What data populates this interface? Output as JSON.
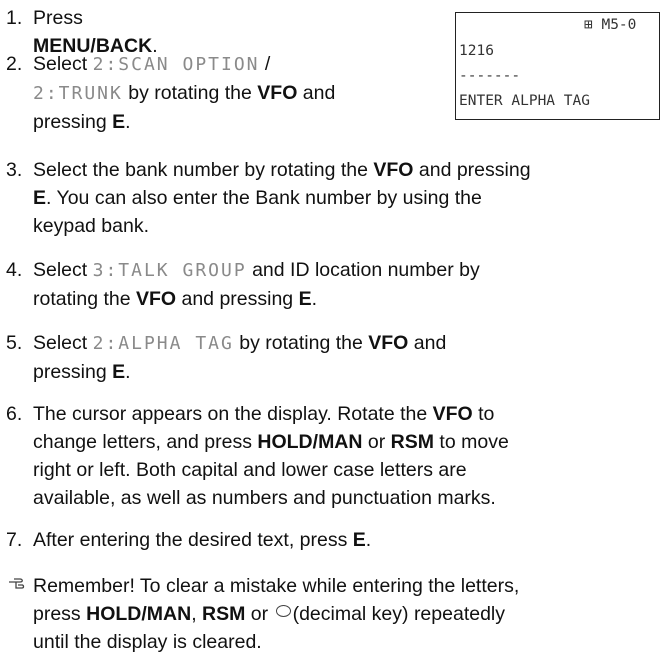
{
  "display": {
    "status": "⊞ M5-0",
    "id": "1216",
    "dashes": "-------",
    "prompt": "ENTER ALPHA TAG"
  },
  "steps": [
    {
      "num": "1.",
      "parts": [
        "Press ",
        "MENU",
        "/",
        "BACK",
        "."
      ]
    },
    {
      "num": "2.",
      "parts": [
        "Select ",
        "2:SCAN OPTION",
        " /",
        "2:TRUNK",
        " by rotating the ",
        "VFO",
        " and",
        "pressing ",
        "E",
        "."
      ]
    },
    {
      "num": "3.",
      "parts": [
        "Select the bank number by rotating the ",
        "VFO",
        " and pressing",
        "E",
        ". You can also enter the Bank number by using the",
        "keypad bank."
      ]
    },
    {
      "num": "4.",
      "parts": [
        "Select ",
        "3:TALK GROUP",
        " and ID location number by",
        "rotating the ",
        "VFO",
        " and pressing ",
        "E",
        "."
      ]
    },
    {
      "num": "5.",
      "parts": [
        "Select ",
        "2:ALPHA TAG",
        " by rotating the ",
        "VFO",
        " and",
        "pressing ",
        "E",
        "."
      ]
    },
    {
      "num": "6.",
      "parts": [
        "The cursor appears on the display. Rotate the ",
        "VFO",
        " to",
        "change letters, and press ",
        "HOLD",
        "/",
        "MAN",
        " or ",
        "RSM",
        " to move",
        "right or left. Both capital and lower case letters are",
        "available, as well as numbers and punctuation marks."
      ]
    },
    {
      "num": "7.",
      "parts": [
        "After entering the desired text, press ",
        "E",
        "."
      ]
    }
  ],
  "note": {
    "icon": "pointing-hand-icon",
    "parts": [
      "Remember! To clear a mistake while entering the letters,",
      "press ",
      "HOLD",
      "/",
      "MAN",
      ", ",
      "RSM",
      " or ",
      "(decimal key) repeatedly",
      "until the display is cleared."
    ]
  }
}
